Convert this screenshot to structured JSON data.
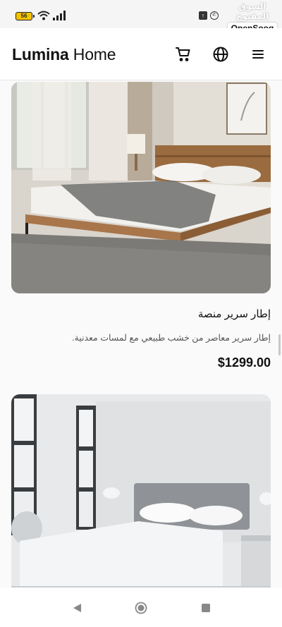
{
  "status_bar": {
    "battery_level": "56",
    "watermark_arabic": "السوق المفتوح",
    "watermark_brand": "OpenSooq"
  },
  "header": {
    "brand_bold": "Lumina",
    "brand_light": "Home",
    "icons": [
      "cart-icon",
      "globe-icon",
      "menu-icon"
    ]
  },
  "products": [
    {
      "title": "إطار سرير منصة",
      "description": "إطار سرير معاصر من خشب طبيعي مع لمسات معدنية.",
      "price": "$1299.00"
    }
  ],
  "colors": {
    "background": "#fafafa",
    "header_bg": "#ffffff",
    "text_primary": "#111111",
    "text_secondary": "#555555",
    "battery": "#f5c400"
  }
}
